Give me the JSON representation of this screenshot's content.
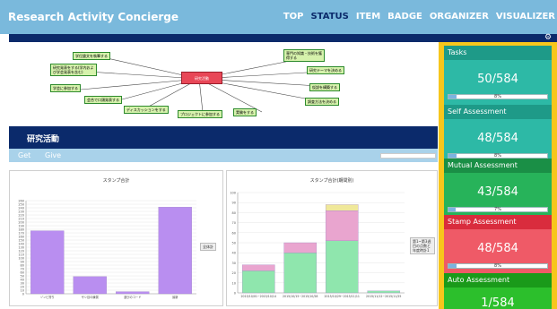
{
  "app": {
    "title": "Research Activity Concierge"
  },
  "nav": {
    "items": [
      "TOP",
      "STATUS",
      "ITEM",
      "BADGE",
      "ORGANIZER",
      "VISUALIZER"
    ],
    "active": "STATUS"
  },
  "map": {
    "center": "研究活動",
    "nodes": [
      "学位論文を執筆する",
      "研究発表をする(学内および学会発表を含む)",
      "学会に参加する",
      "会合で口頭発表する",
      "ディスカッションをする",
      "プロジェクトに参加する",
      "実験をする",
      "調査方法を決める",
      "仮説を構築する",
      "研究テーマを決める",
      "専門の知識・技術を獲得する"
    ]
  },
  "section": {
    "title": "研究活動"
  },
  "tabs": {
    "get": "Get",
    "give": "Give"
  },
  "charts": {
    "left_button": "全体計",
    "right_button": "第1~第3週目の点数と年度時計1"
  },
  "chart_data": [
    {
      "type": "bar",
      "title": "スタンプ合計",
      "categories": [
        "ゾンビ狩り",
        "ザシ目の練習",
        "遊びのコード",
        "最新"
      ],
      "values": [
        176,
        48,
        6,
        242
      ],
      "ylim": [
        0,
        260
      ],
      "colors": [
        "#b98ef0",
        "#b98ef0",
        "#b98ef0",
        "#b98ef0"
      ]
    },
    {
      "type": "bar",
      "title": "スタンプ合計(期間別)",
      "categories": [
        "2015/10/01~2015/10/14",
        "2015/10/15~2015/10/28",
        "2015/10/29~2015/11/11",
        "2015/11/12~2015/11/25"
      ],
      "series": [
        {
          "values": [
            22,
            40,
            52,
            2
          ]
        },
        {
          "values": [
            6,
            10,
            30,
            0
          ]
        },
        {
          "values": [
            0,
            0,
            6,
            0
          ]
        }
      ],
      "ylim": [
        0,
        100
      ],
      "stacked": true,
      "colors": [
        "#8fe6ad",
        "#e9a5cf",
        "#f0e89a"
      ]
    }
  ],
  "sidebar": {
    "cards": [
      {
        "title": "Tasks",
        "value": "50/584",
        "percent_label": "8%",
        "progress": 0.08,
        "head_color": "#1e9a88",
        "body_color": "#2db9a6"
      },
      {
        "title": "Self Assessment",
        "value": "48/584",
        "percent_label": "8%",
        "progress": 0.08,
        "head_color": "#1e9a88",
        "body_color": "#2db9a6"
      },
      {
        "title": "Mutual Assessment",
        "value": "43/584",
        "percent_label": "7%",
        "progress": 0.07,
        "head_color": "#1a8f46",
        "body_color": "#27b35a"
      },
      {
        "title": "Stamp Assessment",
        "value": "48/584",
        "percent_label": "8%",
        "progress": 0.08,
        "head_color": "#d92c3d",
        "body_color": "#ef5a67"
      },
      {
        "title": "Auto Assessment",
        "value": "1/584",
        "percent_label": "",
        "progress": 0.002,
        "head_color": "#1a9a1a",
        "body_color": "#2cbf2c"
      }
    ]
  }
}
